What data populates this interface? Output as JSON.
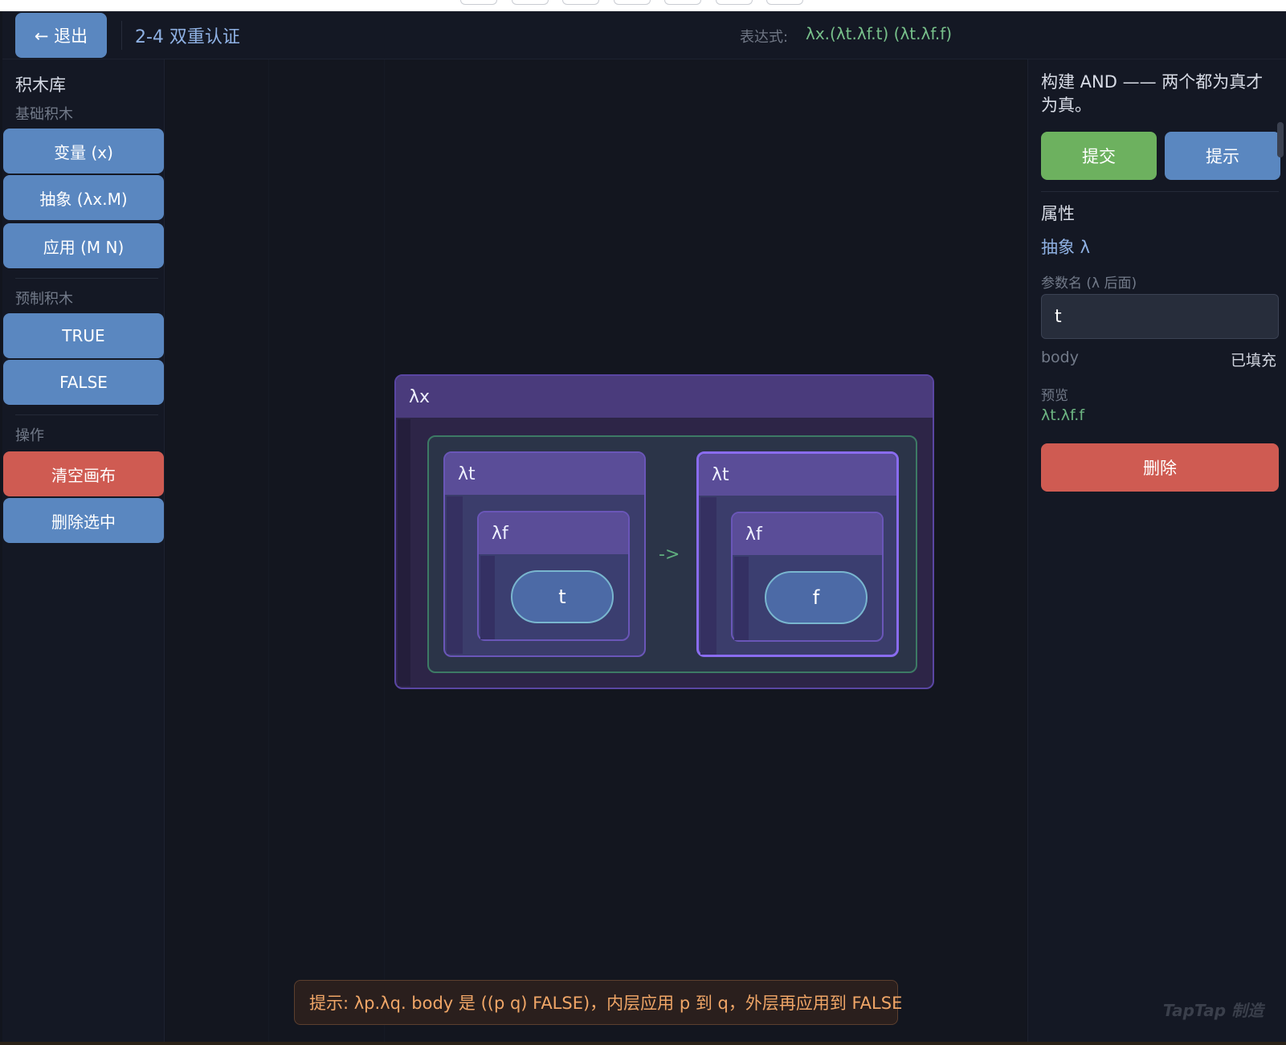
{
  "header": {
    "exit_label": "← 退出",
    "level_title": "2-4 双重认证",
    "expr_label": "表达式:",
    "expr_value": "λx.(λt.λf.t) (λt.λf.f)"
  },
  "sidebar": {
    "title": "积木库",
    "sections": [
      {
        "label": "基础积木",
        "items": [
          "变量 (x)",
          "抽象 (λx.M)",
          "应用 (M N)"
        ]
      },
      {
        "label": "预制积木",
        "items": [
          "TRUE",
          "FALSE"
        ]
      },
      {
        "label": "操作",
        "items": [
          "清空画布",
          "删除选中"
        ]
      }
    ]
  },
  "canvas": {
    "outer_label": "λx",
    "left_lambda_label": "λt",
    "left_inner_label": "λf",
    "left_var": "t",
    "arrow": "->",
    "right_lambda_label": "λt",
    "right_inner_label": "λf",
    "right_var": "f",
    "hint_text": "提示: λp.λq. body 是 ((p q) FALSE)，内层应用 p 到 q，外层再应用到 FALSE"
  },
  "panel": {
    "goal": "构建 AND —— 两个都为真才为真。",
    "submit_label": "提交",
    "hint_label": "提示",
    "props_title": "属性",
    "props_type": "抽象 λ",
    "param_label": "参数名 (λ 后面)",
    "param_value": "t",
    "body_label": "body",
    "body_status": "已填充",
    "preview_label": "预览",
    "preview_value": "λt.λf.f",
    "delete_label": "删除",
    "watermark": "TapTap 制造"
  },
  "colors": {
    "primary_blue": "#5a87c0",
    "danger_red": "#cf5b52",
    "success_green": "#6db15f",
    "lambda_purple": "#5a4d98",
    "selected_border": "#8a6cf0"
  }
}
